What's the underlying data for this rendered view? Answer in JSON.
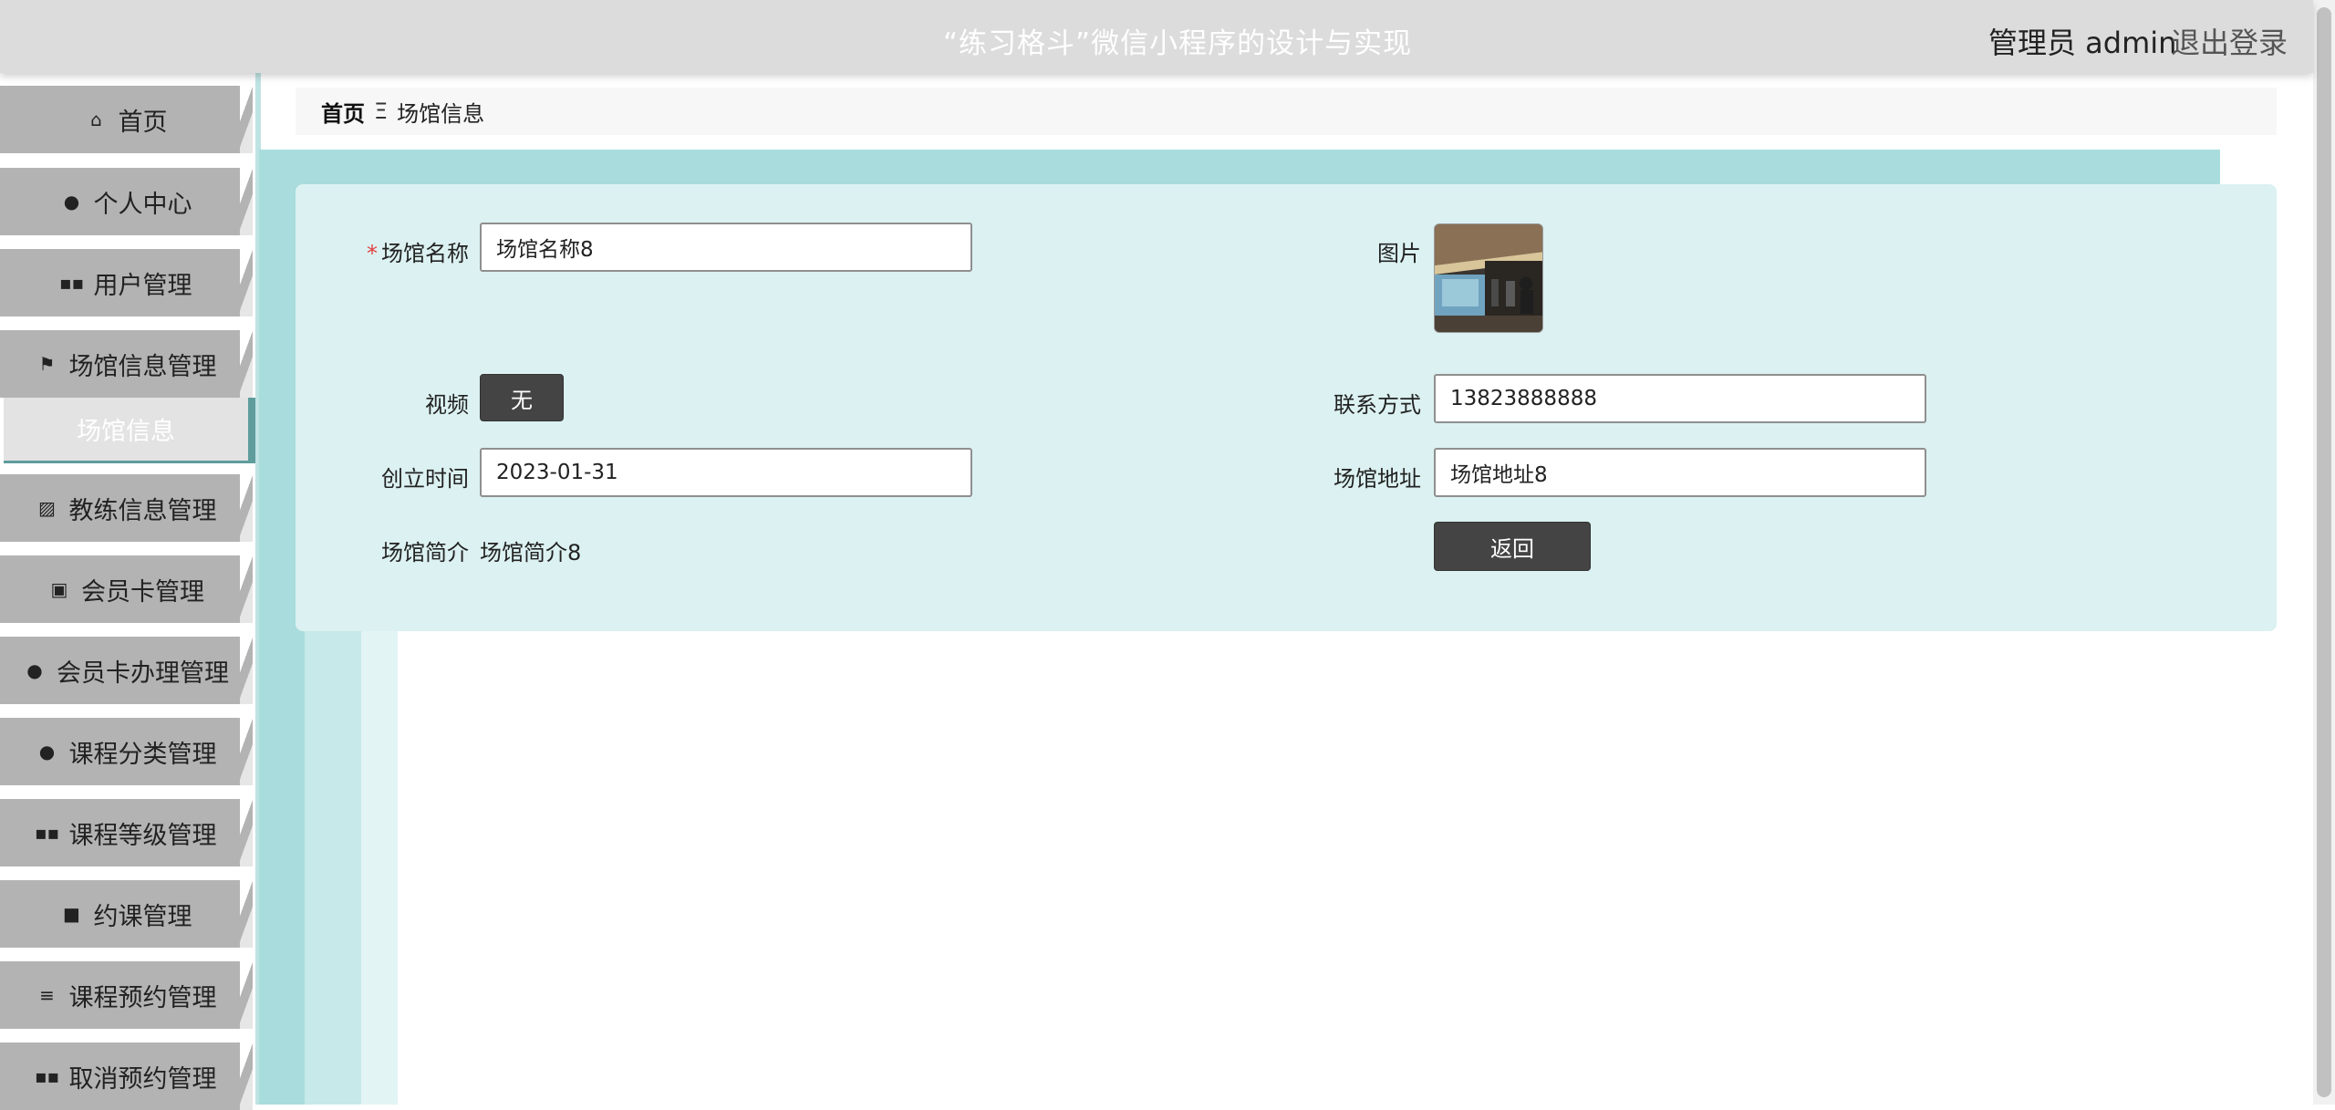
{
  "header": {
    "title": "“练习格斗”微信小程序的设计与实现",
    "user": "管理员 admin",
    "logout": "退出登录"
  },
  "sidebar": {
    "items": [
      {
        "label": "首页",
        "icon": "home-icon"
      },
      {
        "label": "个人中心",
        "icon": "user-icon"
      },
      {
        "label": "用户管理",
        "icon": "grid-icon"
      },
      {
        "label": "场馆信息管理",
        "icon": "flag-icon"
      },
      {
        "label": "场馆信息",
        "icon": ""
      },
      {
        "label": "教练信息管理",
        "icon": "chart-icon"
      },
      {
        "label": "会员卡管理",
        "icon": "clipboard-icon"
      },
      {
        "label": "会员卡办理管理",
        "icon": "bulb-icon"
      },
      {
        "label": "课程分类管理",
        "icon": "user-icon"
      },
      {
        "label": "课程等级管理",
        "icon": "grid-icon"
      },
      {
        "label": "约课管理",
        "icon": "briefcase-icon"
      },
      {
        "label": "课程预约管理",
        "icon": "list-icon"
      },
      {
        "label": "取消预约管理",
        "icon": "grid-icon"
      }
    ]
  },
  "breadcrumb": {
    "home": "首页",
    "separator": "Ξ",
    "current": "场馆信息"
  },
  "form": {
    "name_label": "场馆名称",
    "name_required": "*",
    "name_value": "场馆名称8",
    "image_label": "图片",
    "video_label": "视频",
    "video_value": "无",
    "contact_label": "联系方式",
    "contact_value": "13823888888",
    "created_label": "创立时间",
    "created_value": "2023-01-31",
    "address_label": "场馆地址",
    "address_value": "场馆地址8",
    "intro_label": "场馆简介",
    "intro_value": "场馆简介8",
    "back_button": "返回"
  },
  "colors": {
    "header_bg": "#dcdcdc",
    "sidebar_item_bg": "#b3b3b3",
    "content_teal": "#a9dcdc",
    "card_bg": "#dcf1f1",
    "button_dark": "#444444",
    "required_red": "#e04040"
  }
}
